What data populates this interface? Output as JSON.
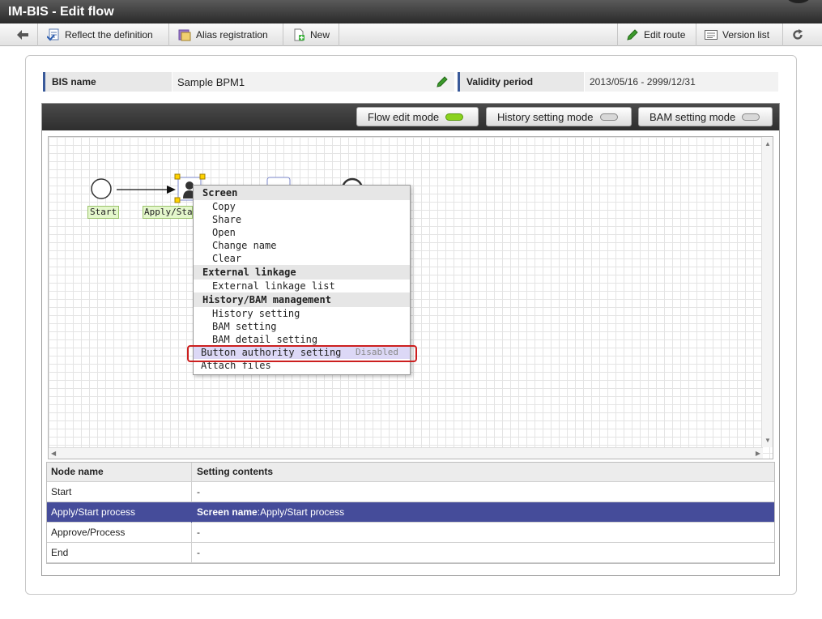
{
  "window": {
    "title": "IM-BIS - Edit flow"
  },
  "toolbar": {
    "back_icon": "arrow-left-icon",
    "reflect": "Reflect the definition",
    "alias": "Alias registration",
    "new": "New",
    "edit_route": "Edit route",
    "version_list": "Version list",
    "refresh_icon": "refresh-icon"
  },
  "info": {
    "bis_name_label": "BIS name",
    "bis_name_value": "Sample BPM1",
    "validity_label": "Validity period",
    "validity_value": "2013/05/16 - 2999/12/31"
  },
  "modes": {
    "flow": "Flow edit mode",
    "history": "History setting mode",
    "bam": "BAM setting mode",
    "active_color": "#8ad21e",
    "inactive_color": "#d8d8d8"
  },
  "flow": {
    "start_label": "Start",
    "apply_label": "Apply/Start"
  },
  "context_menu": {
    "screen_header": "Screen",
    "copy": "Copy",
    "share": "Share",
    "open": "Open",
    "change_name": "Change name",
    "clear": "Clear",
    "external_header": "External linkage",
    "external_list": "External linkage list",
    "history_header": "History/BAM management",
    "history_setting": "History setting",
    "bam_setting": "BAM setting",
    "bam_detail": "BAM detail setting",
    "button_authority": "Button authority setting",
    "button_authority_state": "Disabled",
    "attach_files": "Attach files"
  },
  "table": {
    "col_node": "Node name",
    "col_setting": "Setting contents",
    "rows": [
      {
        "node": "Start",
        "setting": "-"
      },
      {
        "node": "Apply/Start process",
        "setting_key": "Screen name",
        "setting_sep": ":",
        "setting": "Apply/Start process"
      },
      {
        "node": "Approve/Process",
        "setting": "-"
      },
      {
        "node": "End",
        "setting": "-"
      }
    ]
  }
}
